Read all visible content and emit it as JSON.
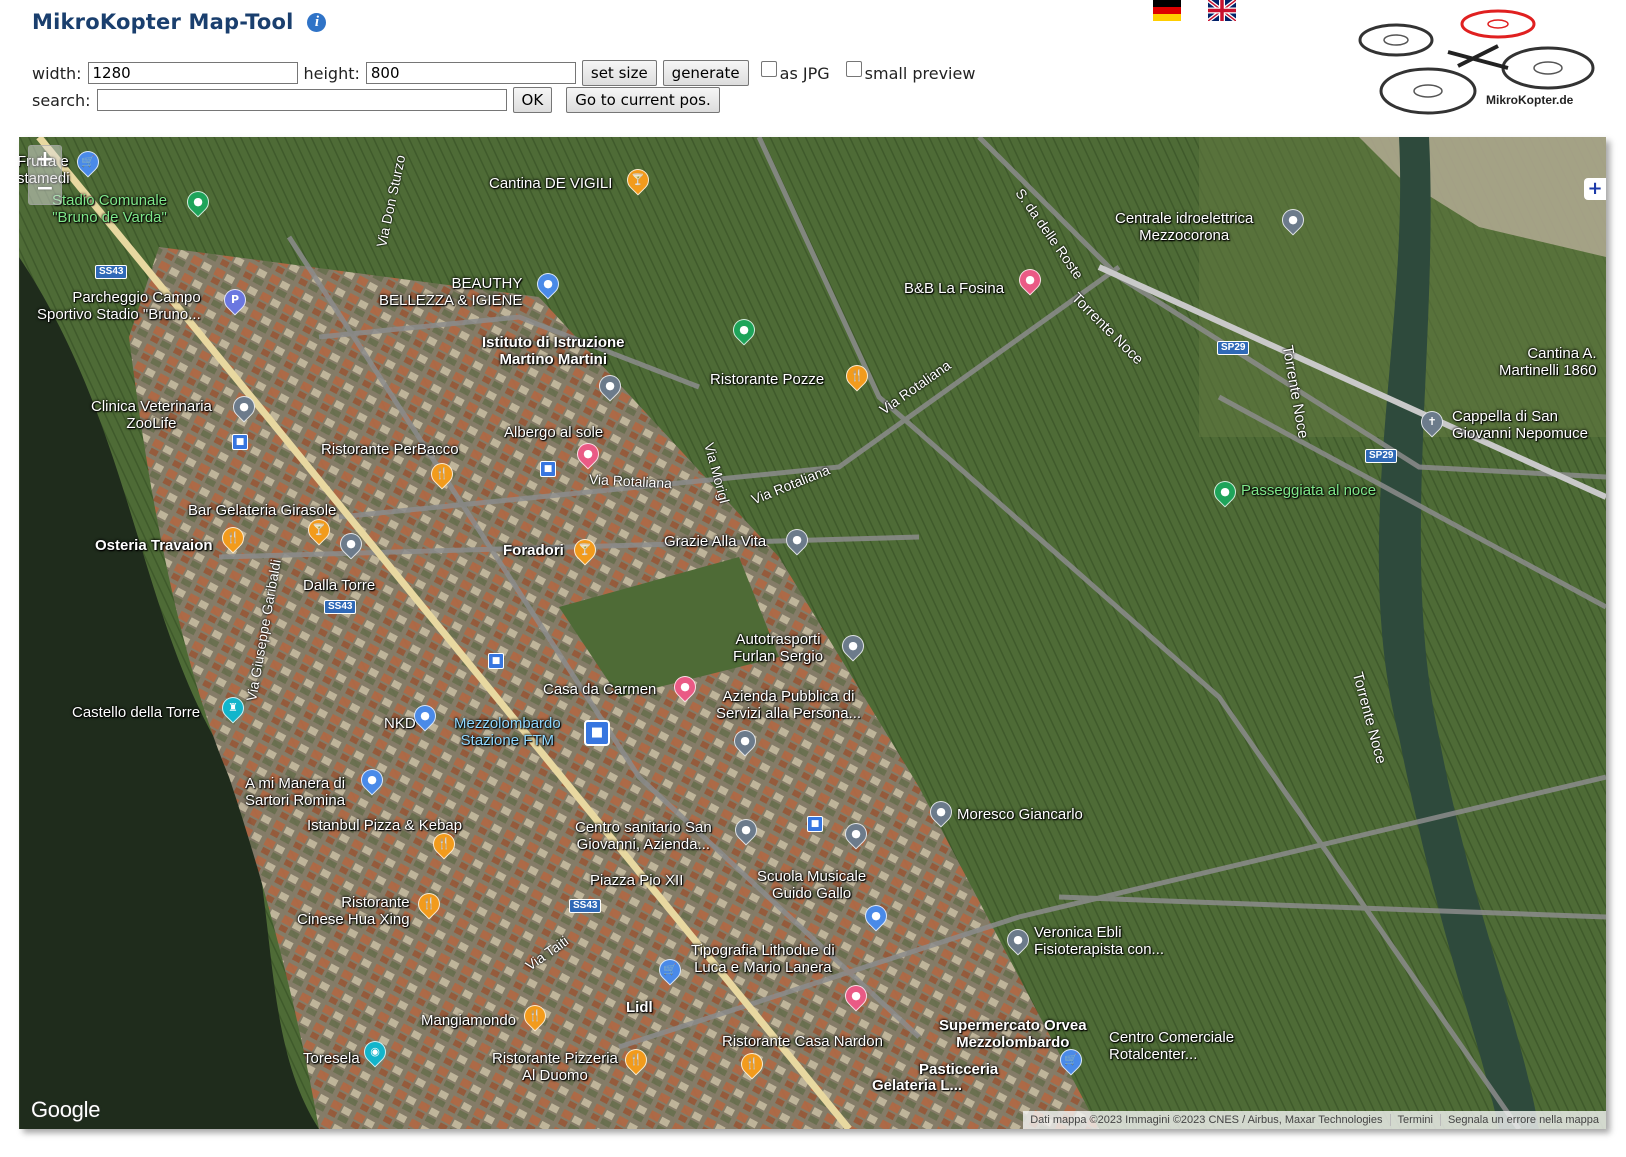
{
  "app": {
    "title": "MikroKopter Map-Tool",
    "logo_text": "MikroKopter.de"
  },
  "controls": {
    "width_label": "width:",
    "width_value": "1280",
    "height_label": "height:",
    "height_value": "800",
    "set_size_label": "set size",
    "generate_label": "generate",
    "jpg_label": "as JPG",
    "preview_label": "small preview",
    "search_label": "search:",
    "search_value": "",
    "ok_label": "OK",
    "current_pos_label": "Go to current pos."
  },
  "map": {
    "zoom_in": "+",
    "zoom_out": "−",
    "expand": "+",
    "google": "Google",
    "attribution": [
      "Dati mappa ©2023 Immagini ©2023 CNES / Airbus, Maxar Technologies",
      "Termini",
      "Segnala un errore nella mappa"
    ],
    "labels": {
      "frutta": "Frutta e\nstamedi",
      "stadio": "Stadio Comunale\n\"Bruno de Varda\"",
      "parcheggio": "Parcheggio Campo\nSportivo Stadio \"Bruno...",
      "clinica": "Clinica Veterinaria\nZooLife",
      "perbacco": "Ristorante PerBacco",
      "girasole": "Bar Gelateria Girasole",
      "travaion": "Osteria Travaion",
      "dallatorre": "Dalla Torre",
      "castello": "Castello della Torre",
      "nkd": "NKD",
      "stazione": "Mezzolombardo\nStazione FTM",
      "amimanera": "A mi Manera di\nSartori Romina",
      "istanbul": "Istanbul Pizza & Kebap",
      "huaxing": "Ristorante\nCinese Hua Xing",
      "mangiamondo": "Mangiamondo",
      "toresela": "Toresela",
      "duomo": "Ristorante Pizzeria\nAl Duomo",
      "nardon": "Ristorante Casa Nardon",
      "lidl": "Lidl",
      "tipografia": "Tipografia Lithodue di\nLuca e Mario Lanera",
      "piazza": "Piazza Pio XII",
      "scuola": "Scuola Musicale\nGuido Gallo",
      "sanitario": "Centro sanitario San\nGiovanni, Azienda...",
      "moresco": "Moresco Giancarlo",
      "azienda": "Azienda Pubblica di\nServizi alla Persona...",
      "carmen": "Casa da Carmen",
      "autotrasporti": "Autotrasporti\nFurlan Sergio",
      "foradori": "Foradori",
      "grazie": "Grazie Alla Vita",
      "albergo": "Albergo al sole",
      "istituto": "Istituto di Istruzione\nMartino Martini",
      "beauthy": "BEAUTHY\nBELLEZZA & IGIENE",
      "vigili": "Cantina DE VIGILI",
      "pozze": "Ristorante Pozze",
      "fosina": "B&B La Fosina",
      "centrale": "Centrale idroelettrica\nMezzocorona",
      "martinelli": "Cantina A.\nMartinelli 1860",
      "cappella": "Cappella di San\nGiovanni Nepomuce",
      "passeggiata": "Passeggiata al noce",
      "veronica": "Veronica Ebli\nFisioterapista con...",
      "orvea": "Supermercato Orvea\nMezzolombardo",
      "rotalcenter": "Centro Comerciale\nRotalcenter...",
      "pasticceria": "Pasticceria",
      "gelateria": "Gelateria L..."
    },
    "roads": {
      "don_sturzo": "Via Don Sturzo",
      "rotaliana1": "Via Rotaliana",
      "rotaliana2": "Via Rotaliana",
      "rotaliana3": "Via Rotaliana",
      "morigl": "Via Morigl",
      "garibaldi": "Via Giuseppe Garibaldi",
      "taiti": "Via Taiti",
      "roste": "S. da delle Roste",
      "noce1": "Torrente Noce",
      "noce2": "Torrente Noce",
      "noce3": "Torrente Noce"
    },
    "shields": {
      "ss43a": "SS43",
      "ss43b": "SS43",
      "ss43c": "SS43",
      "sp29a": "SP29",
      "sp29b": "SP29"
    }
  }
}
